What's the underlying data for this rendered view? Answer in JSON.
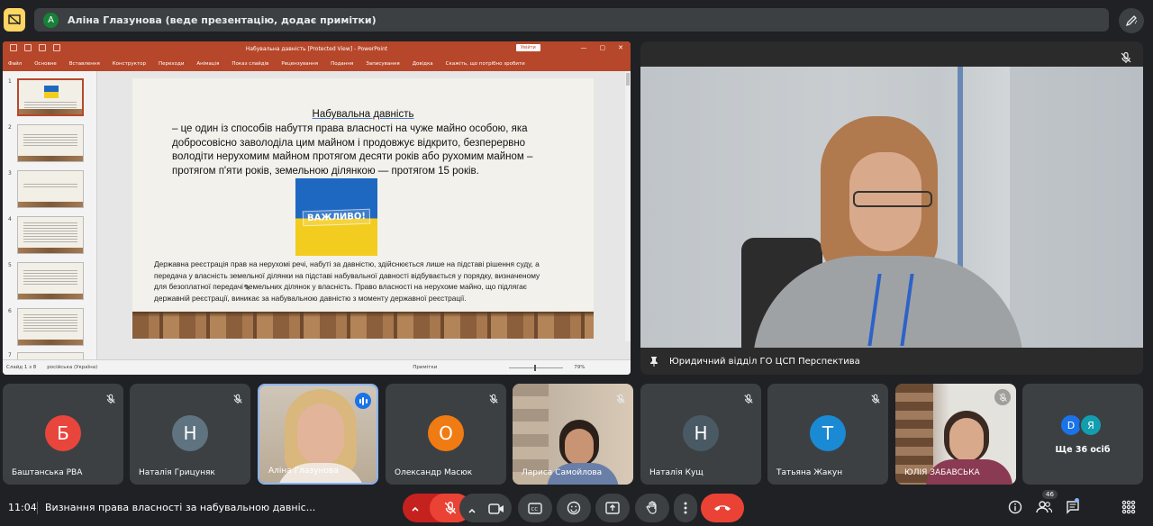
{
  "header": {
    "presenter_initial": "А",
    "presenter_text": "Аліна Глазунова (веде презентацію, додає примітки)"
  },
  "ppt": {
    "window_title": "Набувальна давність [Protected View]  -  PowerPoint",
    "login": "Увійти",
    "menu": [
      "Файл",
      "Основне",
      "Вставлення",
      "Конструктор",
      "Переходи",
      "Анімація",
      "Показ слайдів",
      "Рецензування",
      "Подання",
      "Записування",
      "Довідка",
      "Скажіть, що потрібно зробити"
    ],
    "thumb_numbers": [
      "1",
      "2",
      "3",
      "4",
      "5",
      "6",
      "7"
    ],
    "status": {
      "slide": "Слайд 1 з 8",
      "language": "російська (Україна)",
      "notes": "Примітки",
      "zoom": "79%"
    }
  },
  "slide": {
    "title": "Набувальна давність",
    "definition": "– це один із способів набуття права власності на чуже майно особою, яка добросовісно заволоділа цим майном і продовжує відкрито, безперервно володіти нерухомим майном протягом десяти років або рухомим майном – протягом п'яти років, земельною ділянкою — протягом 15 років.",
    "important_label": "ВАЖЛИВО!",
    "note": "Державна реєстрація прав на нерухомі речі, набуті за давністю, здійснюється лише на підставі рішення суду, а передача у власність земельної ділянки на підставі набувальної давності відбувається у порядку, визначеному для безоплатної передачі земельних ділянок у власність. Право власності на нерухоме майно, що підлягає державній реєстрації, виникає за набувальною давністю з моменту державної реєстрації."
  },
  "main_video": {
    "caption": "Юридичний відділ ГО ЦСП Перспектива"
  },
  "participants": [
    {
      "name": "Баштанська РВА",
      "initial": "Б",
      "color": "#e8453c",
      "muted": true
    },
    {
      "name": "Наталія Грицуняк",
      "initial": "Н",
      "color": "#5f7380",
      "muted": true
    },
    {
      "name": "Аліна Глазунова",
      "initial": "",
      "color": "",
      "muted": false,
      "speaking": true
    },
    {
      "name": "Олександр Масюк",
      "initial": "О",
      "color": "#f07b12",
      "muted": true
    },
    {
      "name": "Лариса Самойлова",
      "initial": "",
      "color": "",
      "muted": true
    },
    {
      "name": "Наталія Кущ",
      "initial": "Н",
      "color": "#4a5a64",
      "muted": true
    },
    {
      "name": "Татьяна Жакун",
      "initial": "Т",
      "color": "#1a8ad4",
      "muted": true
    },
    {
      "name": "ЮЛІЯ ЗАБАВСЬКА",
      "initial": "",
      "color": "",
      "muted": true
    }
  ],
  "more": {
    "avatars": [
      {
        "initial": "D",
        "color": "#1a73e8"
      },
      {
        "initial": "Я",
        "color": "#129eaf"
      }
    ],
    "label": "Ще 36 осіб"
  },
  "bottom": {
    "time": "11:04",
    "meeting_title": "Визнання права власності за набувальною давніс...",
    "people_count": "46"
  },
  "icons": {
    "mic_off": "mic-off-icon",
    "camera": "videocam-icon",
    "captions": "closed-caption-icon",
    "emoji": "emoji-icon",
    "present": "present-screen-icon",
    "raise_hand": "raise-hand-icon",
    "more": "more-vert-icon",
    "end_call": "call-end-icon"
  }
}
